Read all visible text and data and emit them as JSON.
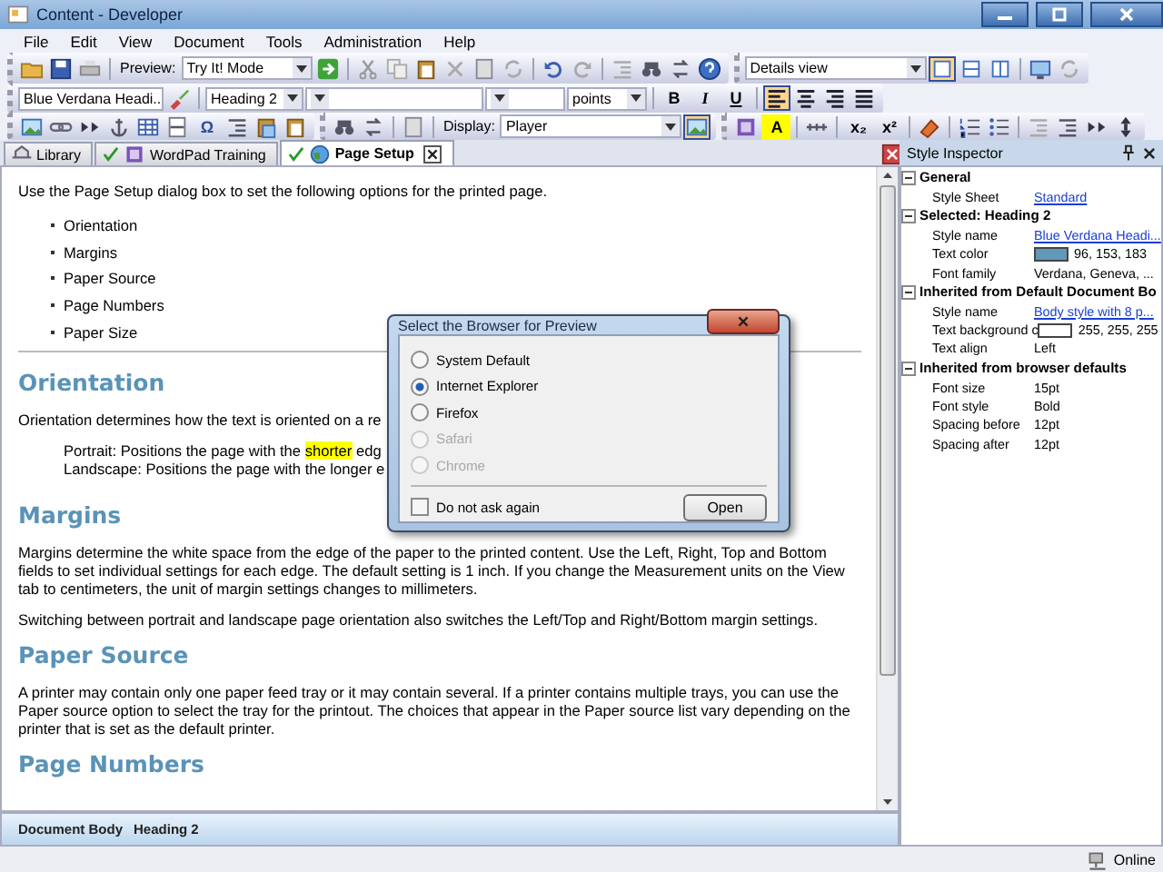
{
  "window": {
    "title": "Content - Developer"
  },
  "menu": [
    "File",
    "Edit",
    "View",
    "Document",
    "Tools",
    "Administration",
    "Help"
  ],
  "toolbar": {
    "preview_label": "Preview:",
    "preview_mode": "Try It! Mode",
    "view_mode": "Details view",
    "layouts": [
      {
        "kind": "single",
        "selected": true
      },
      {
        "kind": "rows",
        "selected": false
      },
      {
        "kind": "columns",
        "selected": false
      }
    ],
    "style": "Blue Verdana Headi...",
    "block_format": "Heading 2",
    "size_unit": "points",
    "format_buttons": [
      "B",
      "I",
      "U"
    ],
    "alignment": [
      {
        "kind": "left",
        "selected": true
      },
      {
        "kind": "center",
        "selected": false
      },
      {
        "kind": "right",
        "selected": false
      },
      {
        "kind": "justify",
        "selected": false
      }
    ],
    "symbol": "Ω",
    "display_label": "Display:",
    "display_mode": "Player",
    "highlight": "A",
    "subscript": "x₂",
    "superscript": "x²"
  },
  "tabs": [
    {
      "label": "Library",
      "checked": false,
      "selected": false,
      "closable": false
    },
    {
      "label": "WordPad Training",
      "checked": true,
      "selected": false,
      "closable": false
    },
    {
      "label": "Page Setup",
      "checked": true,
      "selected": true,
      "closable": true
    }
  ],
  "document": {
    "intro": "Use the Page Setup dialog box to set the following options for the printed page.",
    "bullets": [
      "Orientation",
      "Margins",
      "Paper Source",
      "Page Numbers",
      "Paper Size"
    ],
    "sections": [
      {
        "heading": "Orientation",
        "paragraphs": [
          {
            "kind": "plain",
            "parts": [
              {
                "text": "Orientation determines how the text is oriented on a re",
                "highlighted": false
              }
            ]
          },
          {
            "kind": "indented",
            "parts": [
              {
                "text": "Portrait: Positions the page with the ",
                "highlighted": false
              },
              {
                "text": "shorter",
                "highlighted": true
              },
              {
                "text": " edg",
                "highlighted": false
              }
            ]
          },
          {
            "kind": "indented",
            "parts": [
              {
                "text": "Landscape: Positions the page with the longer e",
                "highlighted": false
              }
            ]
          }
        ]
      },
      {
        "heading": "Margins",
        "paragraphs": [
          {
            "kind": "plain",
            "parts": [
              {
                "text": "Margins determine the white space from the edge of the paper to the printed content. Use the Left, Right, Top and Bottom fields to set individual settings for each edge. The default setting is 1 inch. If you change the Measurement units on the View tab to centimeters, the unit of margin settings changes to millimeters.",
                "highlighted": false
              }
            ]
          },
          {
            "kind": "plain",
            "parts": [
              {
                "text": "Switching between portrait and landscape page orientation also switches the Left/Top and Right/Bottom margin settings.",
                "highlighted": false
              }
            ]
          }
        ]
      },
      {
        "heading": "Paper Source",
        "paragraphs": [
          {
            "kind": "plain",
            "parts": [
              {
                "text": "A printer may contain only one paper feed tray or it may contain several. If a printer contains multiple trays, you can use the Paper source option to select the tray for the printout. The choices that appear in the Paper source list vary depending on the printer that is set as the default printer.",
                "highlighted": false
              }
            ]
          }
        ]
      },
      {
        "heading": "Page Numbers"
      }
    ]
  },
  "breadcrumb": [
    "Document Body",
    "Heading 2"
  ],
  "inspector": {
    "title": "Style Inspector",
    "groups": [
      {
        "title": "General",
        "expanded": true,
        "rows": [
          {
            "kind": "link",
            "name": "Style Sheet",
            "value": "Standard"
          }
        ]
      },
      {
        "title": "Selected: Heading 2",
        "expanded": true,
        "rows": [
          {
            "kind": "link",
            "name": "Style name",
            "value": "Blue Verdana Headi..."
          },
          {
            "kind": "color",
            "name": "Text color",
            "value": "96, 153, 183",
            "color": "#6099b7"
          },
          {
            "kind": "text",
            "name": "Font family",
            "value": "Verdana, Geneva, ..."
          }
        ]
      },
      {
        "title": "Inherited from Default Document Bo",
        "expanded": true,
        "rows": [
          {
            "kind": "link",
            "name": "Style name",
            "value": "Body style with 8 p..."
          },
          {
            "kind": "color",
            "name": "Text background c",
            "value": "255, 255, 255",
            "color": "#ffffff"
          },
          {
            "kind": "text",
            "name": "Text align",
            "value": "Left"
          }
        ]
      },
      {
        "title": "Inherited from browser defaults",
        "expanded": true,
        "rows": [
          {
            "kind": "text",
            "name": "Font size",
            "value": "15pt"
          },
          {
            "kind": "text",
            "name": "Font style",
            "value": "Bold"
          },
          {
            "kind": "text",
            "name": "Spacing before",
            "value": "12pt"
          },
          {
            "kind": "text",
            "name": "Spacing after",
            "value": "12pt"
          }
        ]
      }
    ]
  },
  "dialog": {
    "title": "Select the Browser for Preview",
    "options": [
      {
        "label": "System Default",
        "selected": false,
        "disabled": false
      },
      {
        "label": "Internet Explorer",
        "selected": true,
        "disabled": false
      },
      {
        "label": "Firefox",
        "selected": false,
        "disabled": false
      },
      {
        "label": "Safari",
        "selected": false,
        "disabled": true
      },
      {
        "label": "Chrome",
        "selected": false,
        "disabled": true
      }
    ],
    "checkbox": {
      "label": "Do not ask again",
      "checked": false
    },
    "button": "Open"
  },
  "status_bar": {
    "connection": "Online"
  }
}
